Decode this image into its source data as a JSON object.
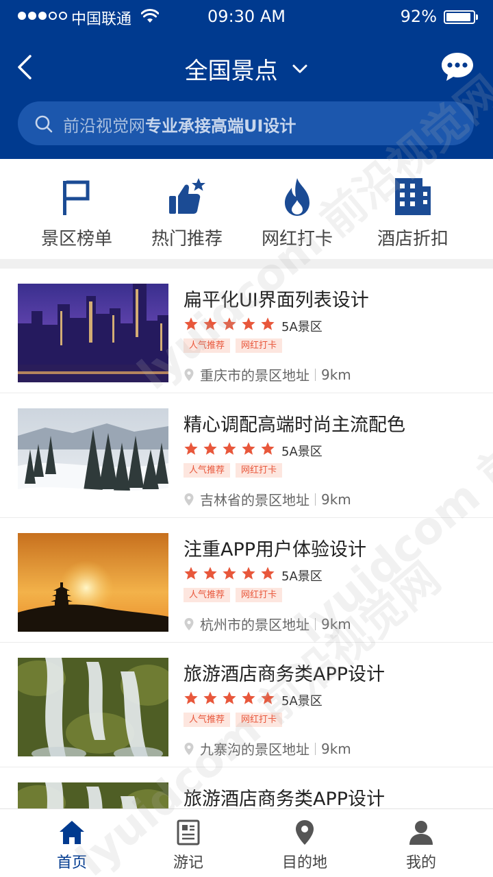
{
  "status_bar": {
    "carrier": "中国联通",
    "time": "09:30 AM",
    "battery": "92%",
    "battery_level": 0.92
  },
  "nav": {
    "title": "全国景点"
  },
  "search": {
    "placeholder_prefix": "前沿视觉网",
    "placeholder_strong": "专业承接高端UI设计"
  },
  "categories": [
    {
      "label": "景区榜单",
      "icon": "flag-icon"
    },
    {
      "label": "热门推荐",
      "icon": "thumbs-up-star-icon"
    },
    {
      "label": "网红打卡",
      "icon": "fire-icon"
    },
    {
      "label": "酒店折扣",
      "icon": "building-icon"
    }
  ],
  "list": [
    {
      "title": "扁平化UI界面列表设计",
      "stars": 5,
      "grade": "5A景区",
      "tags": [
        "人气推荐",
        "网红打卡"
      ],
      "address": "重庆市的景区地址",
      "distance": "9km",
      "image": "city-night-image"
    },
    {
      "title": "精心调配高端时尚主流配色",
      "stars": 5,
      "grade": "5A景区",
      "tags": [
        "人气推荐",
        "网红打卡"
      ],
      "address": "吉林省的景区地址",
      "distance": "9km",
      "image": "snow-forest-image"
    },
    {
      "title": "注重APP用户体验设计",
      "stars": 5,
      "grade": "5A景区",
      "tags": [
        "人气推荐",
        "网红打卡"
      ],
      "address": "杭州市的景区地址",
      "distance": "9km",
      "image": "sunset-pagoda-image"
    },
    {
      "title": "旅游酒店商务类APP设计",
      "stars": 5,
      "grade": "5A景区",
      "tags": [
        "人气推荐",
        "网红打卡"
      ],
      "address": "九寨沟的景区地址",
      "distance": "9km",
      "image": "waterfall-image"
    },
    {
      "title": "旅游酒店商务类APP设计",
      "image": "waterfall-image"
    }
  ],
  "tabs": [
    {
      "label": "首页",
      "icon": "home-icon",
      "active": true
    },
    {
      "label": "游记",
      "icon": "notes-icon",
      "active": false
    },
    {
      "label": "目的地",
      "icon": "location-pin-icon",
      "active": false
    },
    {
      "label": "我的",
      "icon": "user-icon",
      "active": false
    }
  ],
  "colors": {
    "brand": "#003a8f",
    "accent": "#e8573b",
    "tag_bg": "#fde6df"
  },
  "watermark": {
    "text": "lyuidcom 前沿视觉网"
  }
}
